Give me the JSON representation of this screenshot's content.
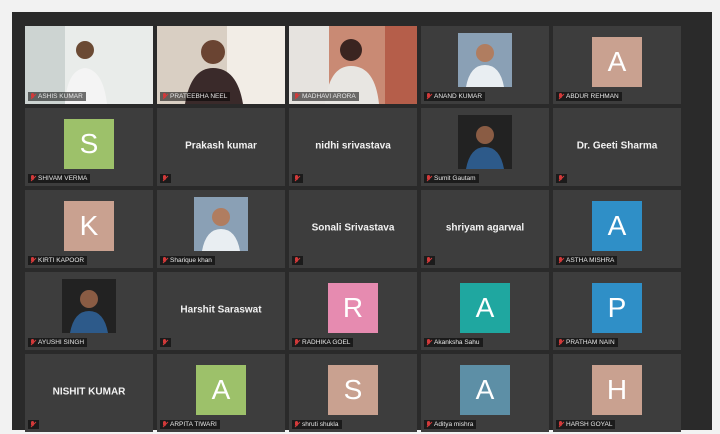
{
  "participants": [
    {
      "name": "ASHIS KUMAR",
      "kind": "video",
      "active": true
    },
    {
      "name": "PRATEEBHA NEEL",
      "kind": "video"
    },
    {
      "name": "MADHAVI ARORA",
      "kind": "video"
    },
    {
      "name": "ANAND KUMAR",
      "kind": "photo"
    },
    {
      "name": "ABDUR REHMAN",
      "kind": "avatar",
      "initial": "A",
      "color": "#c9a190"
    },
    {
      "name": "SHIVAM VERMA",
      "kind": "avatar",
      "initial": "S",
      "color": "#9dc16a"
    },
    {
      "name": "Prakash kumar",
      "kind": "text"
    },
    {
      "name": "nidhi srivastava",
      "kind": "text"
    },
    {
      "name": "Sumit Gautam",
      "kind": "photo"
    },
    {
      "name": "Dr. Geeti Sharma",
      "kind": "text"
    },
    {
      "name": "KIRTI KAPOOR",
      "kind": "avatar",
      "initial": "K",
      "color": "#c9a190"
    },
    {
      "name": "Sharique khan",
      "kind": "photo"
    },
    {
      "name": "Sonali Srivastava",
      "kind": "text"
    },
    {
      "name": "shriyam agarwal",
      "kind": "text"
    },
    {
      "name": "ASTHA MISHRA",
      "kind": "avatar",
      "initial": "A",
      "color": "#2f8fc7"
    },
    {
      "name": "AYUSHI SINGH",
      "kind": "photo"
    },
    {
      "name": "Harshit Saraswat",
      "kind": "text"
    },
    {
      "name": "RADHIKA GOEL",
      "kind": "avatar",
      "initial": "R",
      "color": "#e68bb0"
    },
    {
      "name": "Akanksha Sahu",
      "kind": "avatar",
      "initial": "A",
      "color": "#1fa7a0"
    },
    {
      "name": "PRATHAM NAIN",
      "kind": "avatar",
      "initial": "P",
      "color": "#2f8fc7"
    },
    {
      "name": "NISHIT KUMAR",
      "kind": "text"
    },
    {
      "name": "ARPITA TIWARI",
      "kind": "avatar",
      "initial": "A",
      "color": "#9dc16a"
    },
    {
      "name": "shruti shukla",
      "kind": "avatar",
      "initial": "S",
      "color": "#c9a190"
    },
    {
      "name": "Aditya mishra",
      "kind": "avatar",
      "initial": "A",
      "color": "#5d8fa6"
    },
    {
      "name": "HARSH GOYAL",
      "kind": "avatar",
      "initial": "H",
      "color": "#c9a190"
    }
  ],
  "colors": {
    "active_outline": "#c8ea5a",
    "muted_icon": "#d23a3a",
    "tile_bg": "#3d3d3d"
  },
  "icon_names": [
    "mic-muted-icon"
  ]
}
